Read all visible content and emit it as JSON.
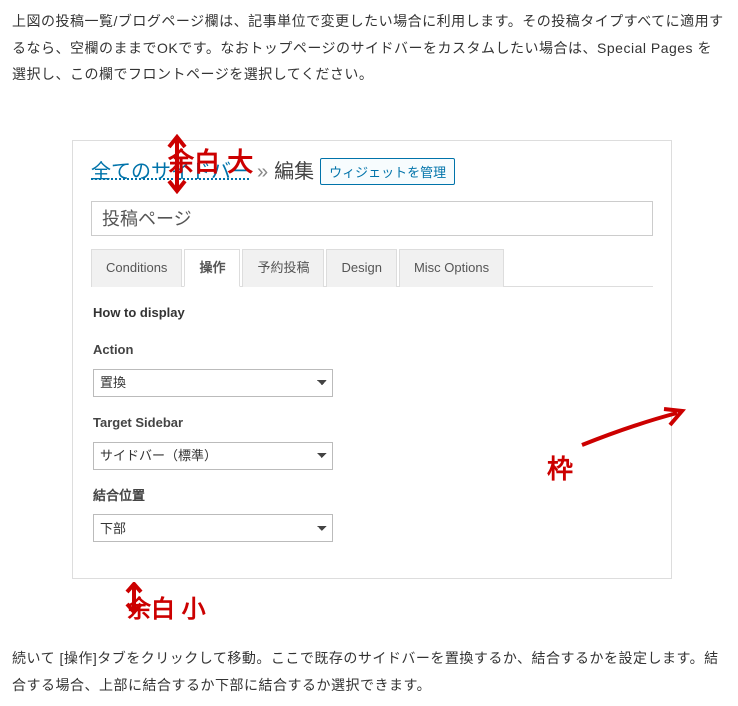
{
  "intro": "上図の投稿一覧/ブログページ欄は、記事単位で変更したい場合に利用します。その投稿タイプすべてに適用するなら、空欄のままでOKです。なおトップページのサイドバーをカスタムしたい場合は、Special Pages を選択し、この欄でフロントページを選択してください。",
  "annot_top": "余白 大",
  "annot_bot": "余白 小",
  "annot_mid": "枠",
  "breadcrumb": {
    "link": "全てのサイドバー",
    "sep": "»",
    "current": "編集"
  },
  "manage_btn": "ウィジェットを管理",
  "title_value": "投稿ページ",
  "tabs": [
    "Conditions",
    "操作",
    "予約投稿",
    "Design",
    "Misc Options"
  ],
  "section_title": "How to display",
  "fields": {
    "action": {
      "label": "Action",
      "value": "置換"
    },
    "target": {
      "label": "Target Sidebar",
      "value": "サイドバー（標準）"
    },
    "merge": {
      "label": "結合位置",
      "value": "下部"
    }
  },
  "outro": "続いて [操作]タブをクリックして移動。ここで既存のサイドバーを置換するか、結合するかを設定します。結合する場合、上部に結合するか下部に結合するか選択できます。"
}
